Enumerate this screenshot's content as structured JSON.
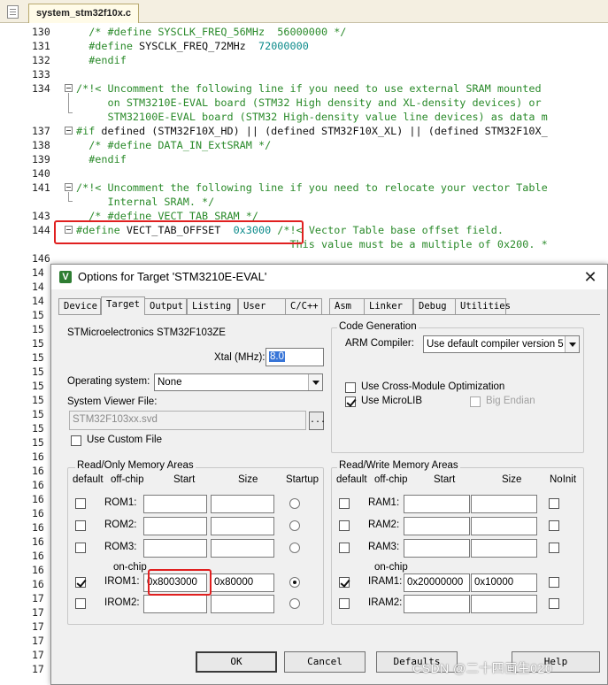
{
  "editor": {
    "file_tab": "system_stm32f10x.c",
    "lines": [
      {
        "num": "130",
        "segments": [
          {
            "t": "  /* #define SYSCLK_FREQ_56MHz  56000000 */",
            "c": "green"
          }
        ]
      },
      {
        "num": "131",
        "segments": [
          {
            "t": "  #define ",
            "c": "green"
          },
          {
            "t": "SYSCLK_FREQ_72MHz",
            "c": "dark"
          },
          {
            "t": "  72000000",
            "c": "teal"
          }
        ]
      },
      {
        "num": "132",
        "segments": [
          {
            "t": "  #endif",
            "c": "green"
          }
        ]
      },
      {
        "num": "133",
        "segments": []
      },
      {
        "num": "134",
        "segments": [
          {
            "t": "/*!< Uncomment the following line if you need to use external SRAM mounted",
            "c": "green"
          }
        ]
      },
      {
        "num": "",
        "segments": [
          {
            "t": "     on STM3210E-EVAL board (STM32 High density and XL-density devices) or",
            "c": "green"
          }
        ]
      },
      {
        "num": "",
        "segments": [
          {
            "t": "     STM32100E-EVAL board (STM32 High-density value line devices) as data m",
            "c": "green"
          }
        ]
      },
      {
        "num": "137",
        "segments": [
          {
            "t": "#if ",
            "c": "green"
          },
          {
            "t": "defined (STM32F10X_HD) || (defined STM32F10X_XL) || (defined STM32F10X_",
            "c": "dark"
          }
        ]
      },
      {
        "num": "138",
        "segments": [
          {
            "t": "  /* #define DATA_IN_ExtSRAM */",
            "c": "green"
          }
        ]
      },
      {
        "num": "139",
        "segments": [
          {
            "t": "  #endif",
            "c": "green"
          }
        ]
      },
      {
        "num": "140",
        "segments": []
      },
      {
        "num": "141",
        "segments": [
          {
            "t": "/*!< Uncomment the following line if you need to relocate your vector Table",
            "c": "green"
          }
        ]
      },
      {
        "num": "",
        "segments": [
          {
            "t": "     Internal SRAM. */",
            "c": "green"
          }
        ]
      },
      {
        "num": "143",
        "segments": [
          {
            "t": "  /* #define VECT_TAB_SRAM */",
            "c": "green"
          }
        ]
      },
      {
        "num": "144",
        "segments": [
          {
            "t": "#define ",
            "c": "green"
          },
          {
            "t": "VECT_TAB_OFFSET",
            "c": "dark"
          },
          {
            "t": "  0x3000",
            "c": "teal"
          },
          {
            "t": " /*!< Vector Table base offset field.",
            "c": "green"
          }
        ]
      },
      {
        "num": "",
        "segments": [
          {
            "t": "                                  This value must be a multiple of 0x200. *",
            "c": "green"
          }
        ]
      },
      {
        "num": "146",
        "segments": []
      },
      {
        "num": "14",
        "segments": []
      },
      {
        "num": "14",
        "segments": []
      },
      {
        "num": "14",
        "segments": []
      },
      {
        "num": "15",
        "segments": []
      },
      {
        "num": "15",
        "segments": []
      },
      {
        "num": "15",
        "segments": []
      },
      {
        "num": "15",
        "segments": []
      },
      {
        "num": "15",
        "segments": []
      },
      {
        "num": "15",
        "segments": []
      },
      {
        "num": "15",
        "segments": []
      },
      {
        "num": "15",
        "segments": []
      },
      {
        "num": "15",
        "segments": []
      },
      {
        "num": "15",
        "segments": []
      },
      {
        "num": "16",
        "segments": []
      },
      {
        "num": "16",
        "segments": []
      },
      {
        "num": "16",
        "segments": []
      },
      {
        "num": "16",
        "segments": []
      },
      {
        "num": "16",
        "segments": []
      },
      {
        "num": "16",
        "segments": []
      },
      {
        "num": "16",
        "segments": []
      },
      {
        "num": "16",
        "segments": []
      },
      {
        "num": "16",
        "segments": []
      },
      {
        "num": "16",
        "segments": []
      },
      {
        "num": "17",
        "segments": []
      },
      {
        "num": "17",
        "segments": []
      },
      {
        "num": "17",
        "segments": []
      },
      {
        "num": "17",
        "segments": []
      },
      {
        "num": "17",
        "segments": []
      },
      {
        "num": "17",
        "segments": []
      }
    ],
    "colors": {
      "green": "#2a8a2a",
      "dark": "#111111",
      "teal": "#0a8a8a",
      "highlight": "#e02020"
    }
  },
  "dialog": {
    "title": "Options for Target 'STM3210E-EVAL'",
    "close": "✕",
    "icon_letter": "V",
    "tabs": [
      "Device",
      "Target",
      "Output",
      "Listing",
      "User",
      "C/C++",
      "Asm",
      "Linker",
      "Debug",
      "Utilities"
    ],
    "active_tab": "Target",
    "device_name": "STMicroelectronics STM32F103ZE",
    "xtal_label": "Xtal (MHz):",
    "xtal_value": "8.0",
    "os_label": "Operating system:",
    "os_value": "None",
    "svd_label": "System Viewer File:",
    "svd_value": "STM32F103xx.svd",
    "svd_browse": "...",
    "use_custom_file": "Use Custom File",
    "code_gen": {
      "title": "Code Generation",
      "arm_compiler_label": "ARM Compiler:",
      "arm_compiler_value": "Use default compiler version 5",
      "cross_module": "Use Cross-Module Optimization",
      "microlib": "Use MicroLIB",
      "big_endian": "Big Endian"
    },
    "ro_mem": {
      "title": "Read/Only Memory Areas",
      "headers": {
        "default": "default",
        "offchip": "off-chip",
        "start": "Start",
        "size": "Size",
        "startup": "Startup"
      },
      "onchip": "on-chip",
      "rows": [
        {
          "name": "ROM1:",
          "start": "",
          "size": "",
          "default": false,
          "startup": false
        },
        {
          "name": "ROM2:",
          "start": "",
          "size": "",
          "default": false,
          "startup": false
        },
        {
          "name": "ROM3:",
          "start": "",
          "size": "",
          "default": false,
          "startup": false
        },
        {
          "name": "IROM1:",
          "start": "0x8003000",
          "size": "0x80000",
          "default": true,
          "startup": true
        },
        {
          "name": "IROM2:",
          "start": "",
          "size": "",
          "default": false,
          "startup": false
        }
      ]
    },
    "rw_mem": {
      "title": "Read/Write Memory Areas",
      "headers": {
        "default": "default",
        "offchip": "off-chip",
        "start": "Start",
        "size": "Size",
        "noinit": "NoInit"
      },
      "onchip": "on-chip",
      "rows": [
        {
          "name": "RAM1:",
          "start": "",
          "size": "",
          "default": false,
          "noinit": false
        },
        {
          "name": "RAM2:",
          "start": "",
          "size": "",
          "default": false,
          "noinit": false
        },
        {
          "name": "RAM3:",
          "start": "",
          "size": "",
          "default": false,
          "noinit": false
        },
        {
          "name": "IRAM1:",
          "start": "0x20000000",
          "size": "0x10000",
          "default": true,
          "noinit": false
        },
        {
          "name": "IRAM2:",
          "start": "",
          "size": "",
          "default": false,
          "noinit": false
        }
      ]
    },
    "buttons": {
      "ok": "OK",
      "cancel": "Cancel",
      "defaults": "Defaults",
      "help": "Help"
    }
  },
  "watermark": "CSDN @二十四画生020"
}
